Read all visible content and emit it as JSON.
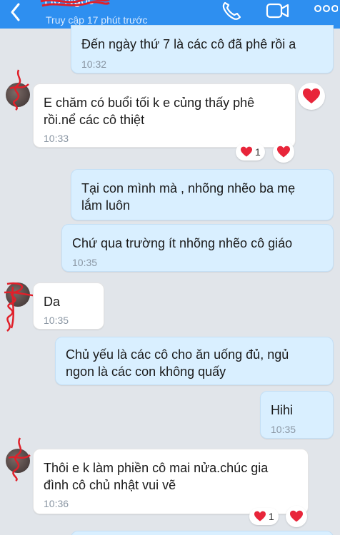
{
  "header": {
    "contact_name": "Ho Ngoc",
    "last_seen": "Truy cập 17 phút trước"
  },
  "colors": {
    "header": "#2e8ff0",
    "outgoing": "#d9efff",
    "incoming": "#ffffff",
    "heart": "#e8253a"
  },
  "messages": [
    {
      "direction": "out",
      "text": "Đến ngày thứ 7 là các cô đã phê rồi a",
      "time": "10:32"
    },
    {
      "direction": "in",
      "line1": "E chăm có buổi tối k e củng thấy phê",
      "line2": "rồi.nể các cô thiệt",
      "time": "10:33",
      "reaction_count": "1"
    },
    {
      "direction": "out",
      "line1": "Tại con mình mà , nhõng nhẽo ba mẹ",
      "line2": "lắm luôn"
    },
    {
      "direction": "out",
      "text": "Chứ qua trường ít nhõng nhẽo cô giáo",
      "time": "10:35"
    },
    {
      "direction": "in",
      "text": "Da",
      "time": "10:35"
    },
    {
      "direction": "out",
      "line1": "Chủ yếu là các cô cho ăn uống đủ, ngủ",
      "line2": "ngon là các con không quấy"
    },
    {
      "direction": "out",
      "text": "Hihi",
      "time": "10:35"
    },
    {
      "direction": "in",
      "line1": "Thôi e k làm phiền cô mai nửa.chúc gia",
      "line2": "đình cô chủ nhật vui vẽ",
      "time": "10:36",
      "reaction_count": "1"
    }
  ]
}
